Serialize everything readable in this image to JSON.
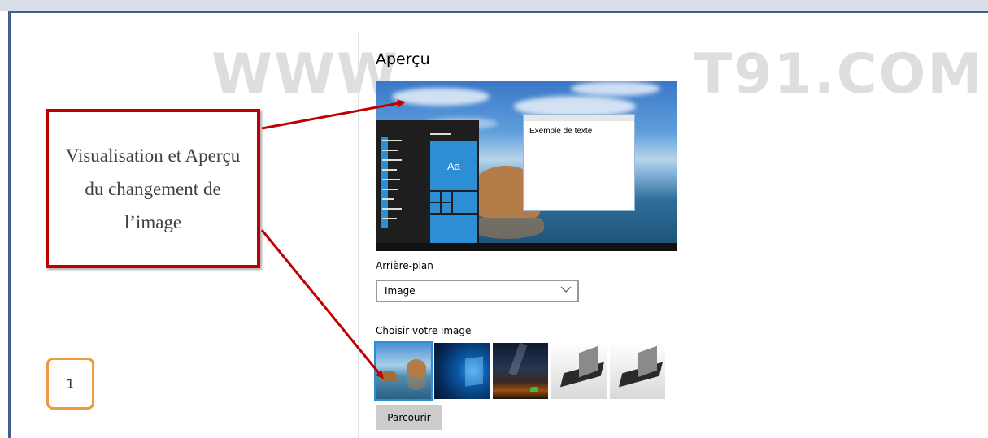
{
  "watermark": {
    "left": "WWW",
    "right": "T91.COM"
  },
  "panel": {
    "title": "Aperçu",
    "preview": {
      "sample_text": "Exemple de texte",
      "tile_label": "Aa"
    },
    "background_label": "Arrière-plan",
    "background_select": {
      "value": "Image"
    },
    "choose_label": "Choisir votre image",
    "thumbnails": [
      "beach-rock-wallpaper",
      "windows-logo-wallpaper",
      "night-sky-tent-wallpaper",
      "laptop-wallpaper",
      "laptop-wallpaper"
    ],
    "browse_button": "Parcourir"
  },
  "annotation": {
    "callout_text": "Visualisation et Aperçu du changement de l’image",
    "step_number": "1"
  },
  "colors": {
    "accent": "#2c8fd6",
    "callout_border": "#c00000",
    "badge_border": "#f09a3e",
    "frame": "#3f5f90"
  }
}
